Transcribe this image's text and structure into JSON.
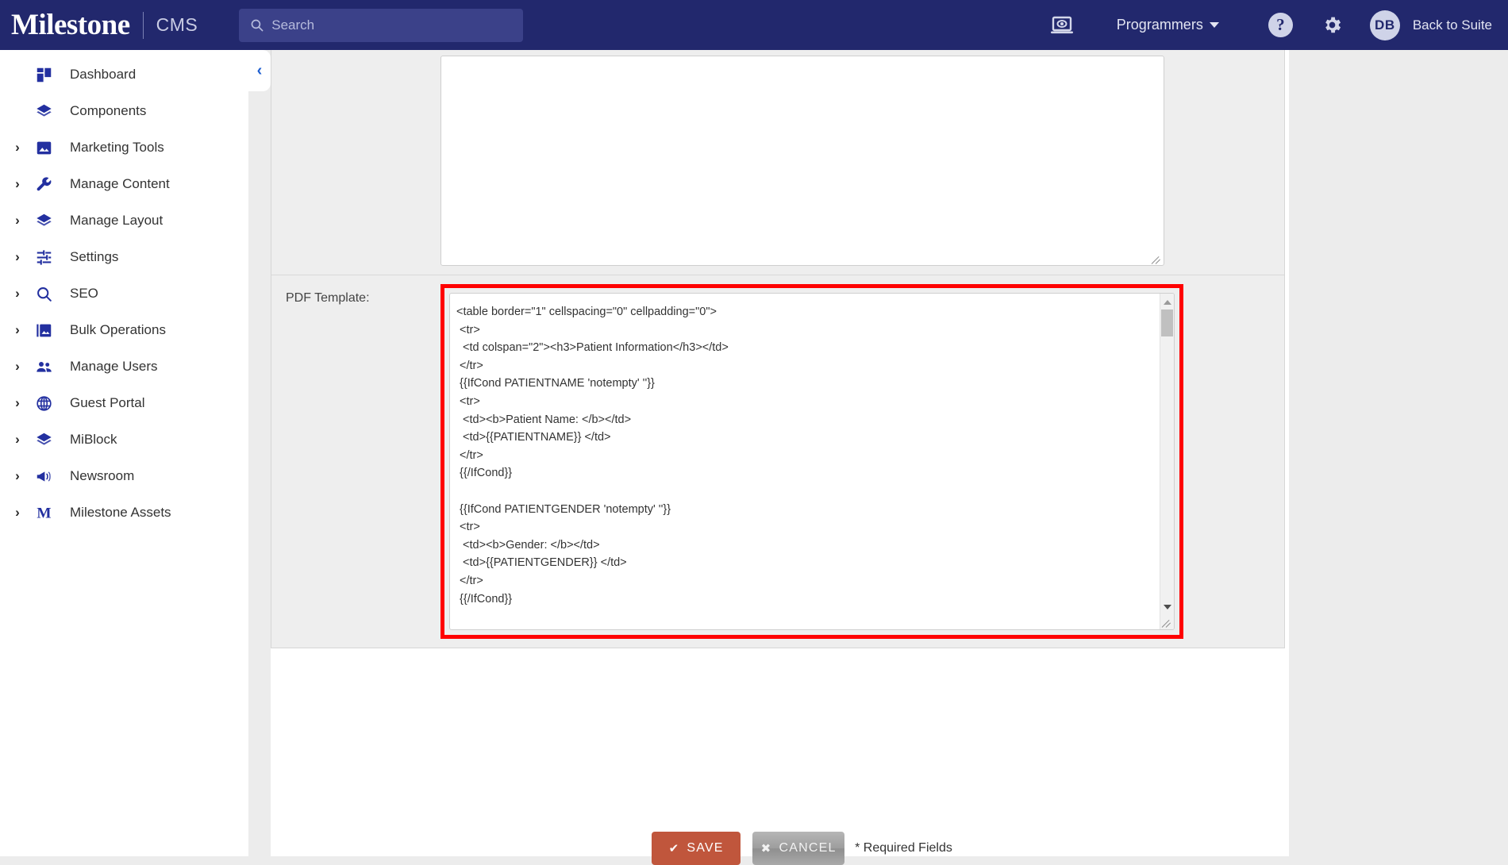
{
  "header": {
    "logo": "Milestone",
    "product": "CMS",
    "search": {
      "placeholder": "Search",
      "icon": "search-icon",
      "value": ""
    },
    "preview_icon": "laptop-preview-icon",
    "account_menu": {
      "label": "Programmers",
      "caret": "chevron-down-icon"
    },
    "help_icon": "help-circle-icon",
    "help_glyph": "?",
    "settings_icon": "gear-icon",
    "avatar": {
      "initials": "DB",
      "name": "avatar"
    },
    "back_to_suite": "Back to Suite",
    "bg_color": "#22286d",
    "search_bg_color": "#3b4189"
  },
  "sidebar": {
    "collapse_toggle": {
      "icon": "chevron-left-icon",
      "glyph": "‹"
    },
    "items": [
      {
        "label": "Dashboard",
        "icon": "dashboard-grid-icon",
        "expandable": false
      },
      {
        "label": "Components",
        "icon": "layers-icon",
        "expandable": false
      },
      {
        "label": "Marketing Tools",
        "icon": "image-icon",
        "expandable": true
      },
      {
        "label": "Manage Content",
        "icon": "wrench-icon",
        "expandable": true
      },
      {
        "label": "Manage Layout",
        "icon": "layers-icon",
        "expandable": true
      },
      {
        "label": "Settings",
        "icon": "sliders-icon",
        "expandable": true
      },
      {
        "label": "SEO",
        "icon": "search-icon",
        "expandable": true
      },
      {
        "label": "Bulk Operations",
        "icon": "photo-library-icon",
        "expandable": true
      },
      {
        "label": "Manage Users",
        "icon": "people-icon",
        "expandable": true
      },
      {
        "label": "Guest Portal",
        "icon": "globe-icon",
        "expandable": true
      },
      {
        "label": "MiBlock",
        "icon": "layers-icon",
        "expandable": true
      },
      {
        "label": "Newsroom",
        "icon": "megaphone-icon",
        "expandable": true
      },
      {
        "label": "Milestone Assets",
        "icon": "milestone-m-icon",
        "expandable": true
      }
    ],
    "chevron_glyph": "›"
  },
  "form": {
    "rows": [
      {
        "label": "",
        "field_type": "textarea",
        "value": ""
      },
      {
        "label": "PDF Template:",
        "field_type": "textarea-highlighted",
        "value": "<table border=\"1\" cellspacing=\"0\" cellpadding=\"0\">\n <tr>\n  <td colspan=\"2\"><h3>Patient Information</h3></td>\n </tr>\n {{IfCond PATIENTNAME 'notempty' ''}}\n <tr>\n  <td><b>Patient Name: </b></td>\n  <td>{{PATIENTNAME}} </td>\n </tr>\n {{/IfCond}}\n\n {{IfCond PATIENTGENDER 'notempty' ''}}\n <tr>\n  <td><b>Gender: </b></td>\n  <td>{{PATIENTGENDER}} </td>\n </tr>\n {{/IfCond}}\n\n {{IfCond PATIENTSSN 'notempty' ''}}"
      }
    ],
    "highlight_color": "#ff0000"
  },
  "footer": {
    "save_label": "SAVE",
    "save_icon": "check-icon",
    "save_glyph": "✔",
    "save_color": "#c0563c",
    "cancel_label": "CANCEL",
    "cancel_icon": "close-x-icon",
    "cancel_glyph": "✖",
    "required_note": "* Required Fields"
  }
}
